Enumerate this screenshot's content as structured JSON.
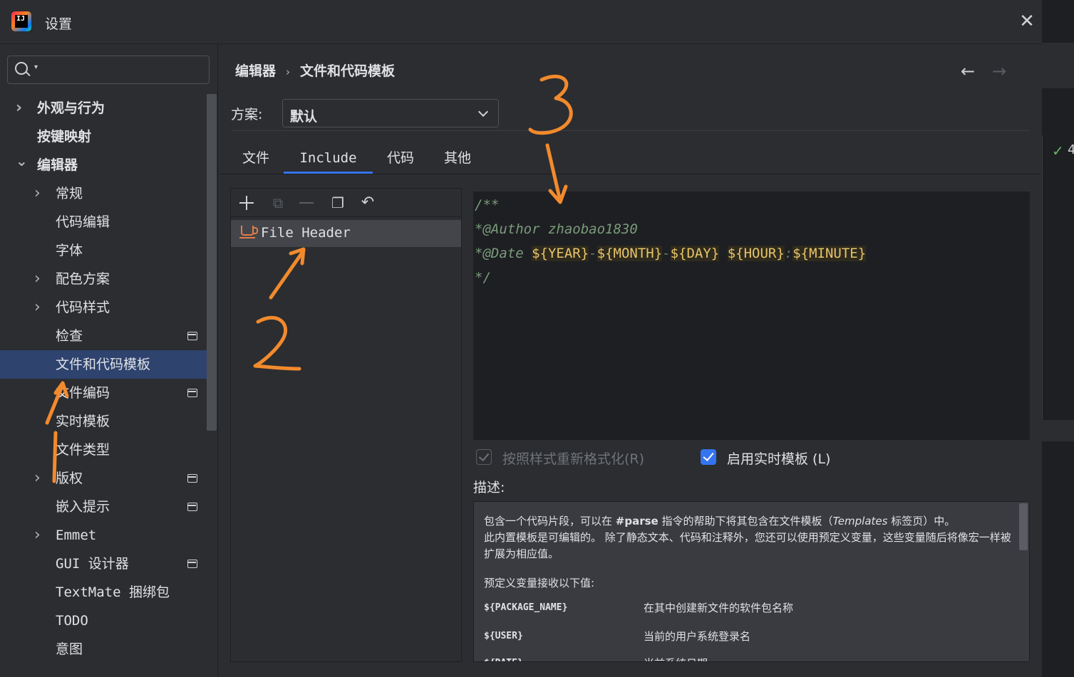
{
  "window": {
    "title": "设置",
    "logo_text": "IJ"
  },
  "search": {
    "placeholder": ""
  },
  "sidebar": {
    "items": [
      {
        "label": "外观与行为",
        "level": 0,
        "chevron": "right",
        "bold": true
      },
      {
        "label": "按键映射",
        "level": 0,
        "chevron": "",
        "bold": true
      },
      {
        "label": "编辑器",
        "level": 0,
        "chevron": "down",
        "bold": true
      },
      {
        "label": "常规",
        "level": 1,
        "chevron": "right"
      },
      {
        "label": "代码编辑",
        "level": 1,
        "chevron": ""
      },
      {
        "label": "字体",
        "level": 1,
        "chevron": ""
      },
      {
        "label": "配色方案",
        "level": 1,
        "chevron": "right"
      },
      {
        "label": "代码样式",
        "level": 1,
        "chevron": "right"
      },
      {
        "label": "检查",
        "level": 1,
        "chevron": "",
        "badge": true
      },
      {
        "label": "文件和代码模板",
        "level": 1,
        "chevron": "",
        "selected": true
      },
      {
        "label": "文件编码",
        "level": 1,
        "chevron": "",
        "badge": true
      },
      {
        "label": "实时模板",
        "level": 1,
        "chevron": ""
      },
      {
        "label": "文件类型",
        "level": 1,
        "chevron": ""
      },
      {
        "label": "版权",
        "level": 1,
        "chevron": "right",
        "badge": true
      },
      {
        "label": "嵌入提示",
        "level": 1,
        "chevron": "",
        "badge": true
      },
      {
        "label": "Emmet",
        "level": 1,
        "chevron": "right"
      },
      {
        "label": "GUI 设计器",
        "level": 1,
        "chevron": "",
        "badge": true
      },
      {
        "label": "TextMate 捆绑包",
        "level": 1,
        "chevron": ""
      },
      {
        "label": "TODO",
        "level": 1,
        "chevron": ""
      },
      {
        "label": "意图",
        "level": 1,
        "chevron": ""
      }
    ]
  },
  "breadcrumb": {
    "parent": "编辑器",
    "current": "文件和代码模板"
  },
  "scheme": {
    "label": "方案:",
    "value": "默认"
  },
  "tabs": [
    {
      "label": "文件",
      "active": false
    },
    {
      "label": "Include",
      "active": true
    },
    {
      "label": "代码",
      "active": false
    },
    {
      "label": "其他",
      "active": false
    }
  ],
  "templates": [
    {
      "name": "File Header"
    }
  ],
  "editor": {
    "line1": "/**",
    "line2_tag": "*@Author",
    "line2_value": " zhaobao1830",
    "line3_tag": "*@Date",
    "vars": {
      "year": "${YEAR}",
      "month": "${MONTH}",
      "day": "${DAY}",
      "hour": "${HOUR}",
      "minute": "${MINUTE}"
    },
    "sep_dash": "-",
    "sep_colon": ":",
    "line4": "*/"
  },
  "options": {
    "reformat": {
      "label": "按照样式重新格式化(R)",
      "checked": true,
      "enabled": false
    },
    "live_templates": {
      "label": "启用实时模板 (L)",
      "checked": true,
      "enabled": true
    }
  },
  "description": {
    "label": "描述:",
    "p1_a": "包含一个代码片段，可以在 ",
    "p1_b": "#parse",
    "p1_c": " 指令的帮助下将其包含在文件模板（",
    "p1_d": "Templates",
    "p1_e": " 标签页）中。",
    "p2": "此内置模板是可编辑的。 除了静态文本、代码和注释外，您还可以使用预定义变量，这些变量随后将像宏一样被扩展为相应值。",
    "p3": "预定义变量接收以下值:",
    "vars": [
      {
        "key": "${PACKAGE_NAME}",
        "desc": "在其中创建新文件的软件包名称"
      },
      {
        "key": "${USER}",
        "desc": "当前的用户系统登录名"
      },
      {
        "key": "${DATE}",
        "desc": "当前系统日期"
      }
    ]
  },
  "colors": {
    "accent": "#3574f0",
    "selection": "#2e436e",
    "annotation": "#f28a2d"
  }
}
